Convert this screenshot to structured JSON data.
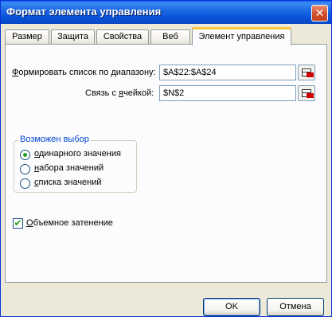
{
  "window": {
    "title": "Формат элемента управления",
    "close_glyph": "✕"
  },
  "tabs": [
    {
      "label": "Размер"
    },
    {
      "label": "Защита"
    },
    {
      "label": "Свойства"
    },
    {
      "label": "Веб"
    },
    {
      "label": "Элемент управления",
      "active": true
    }
  ],
  "form": {
    "range_label": "Формировать список по диапазону:",
    "range_label_accel": "Ф",
    "range_label_rest": "ормировать список по диапазону:",
    "range_value": "$A$22:$A$24",
    "link_label_pre": "Связь с ",
    "link_label_accel": "я",
    "link_label_rest": "чейкой:",
    "link_value": "$N$2"
  },
  "selection": {
    "title": "Возможен выбор",
    "options": [
      {
        "label": "одинарного значения",
        "accel": "о",
        "rest": "динарного значения",
        "selected": true
      },
      {
        "label": "набора значений",
        "accel": "н",
        "rest": "абора значений",
        "selected": false
      },
      {
        "label": "списка значений",
        "accel": "с",
        "rest": "писка значений",
        "selected": false
      }
    ]
  },
  "shading": {
    "label": "Объемное затенение",
    "accel": "О",
    "rest": "бъемное затенение",
    "checked": true,
    "check_glyph": "✔"
  },
  "buttons": {
    "ok": "OK",
    "cancel": "Отмена"
  },
  "colors": {
    "title_bar": "#0a5ce8",
    "active_tab_accent": "#ffc83c",
    "group_title": "#0046d5",
    "check_green": "#21a121",
    "ref_arrow_red": "#d00000"
  },
  "icons": {
    "close": "close-icon",
    "range_ref": "collapse-dialog-icon",
    "link_ref": "collapse-dialog-icon"
  }
}
